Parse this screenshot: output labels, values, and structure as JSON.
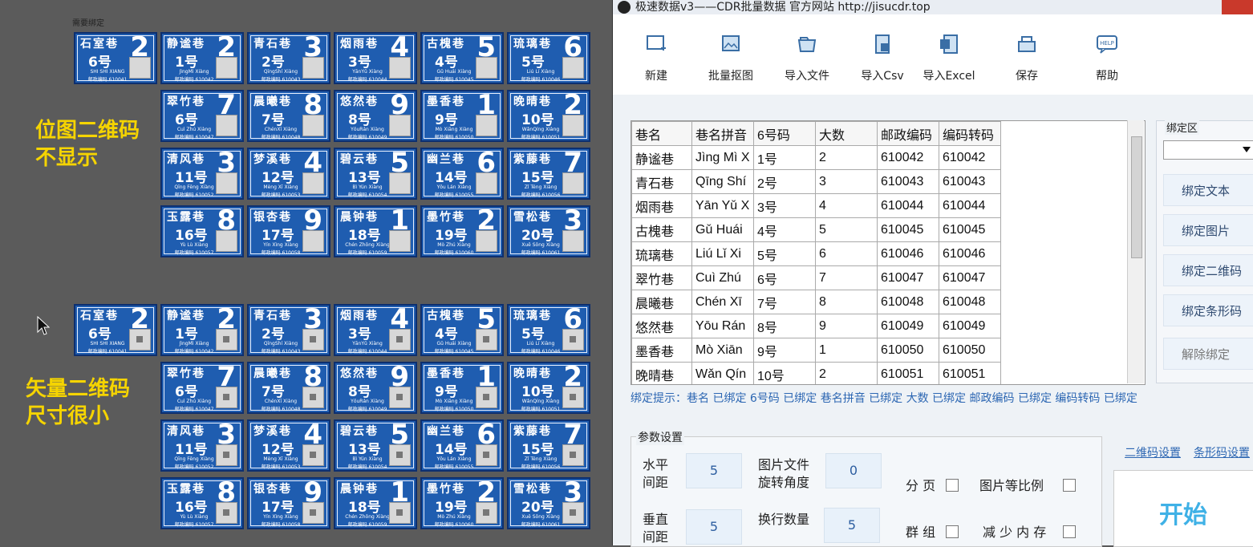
{
  "left": {
    "need_bind_label": "需要绑定",
    "callout_top": [
      "位图二维码",
      "不显示"
    ],
    "callout_bottom": [
      "矢量二维码",
      "尺寸很小"
    ]
  },
  "plates": [
    {
      "street": "石室巷",
      "hno": "6号",
      "big": "2",
      "py": "SHI SHI XIANG",
      "pc": "邮政编码 610041"
    },
    {
      "street": "静谧巷",
      "hno": "1号",
      "big": "2",
      "py": "JìngMì Xiàng",
      "pc": "邮政编码 610042"
    },
    {
      "street": "青石巷",
      "hno": "2号",
      "big": "3",
      "py": "QīngShí Xiàng",
      "pc": "邮政编码 610043"
    },
    {
      "street": "烟雨巷",
      "hno": "3号",
      "big": "4",
      "py": "YānYǔ Xiàng",
      "pc": "邮政编码 610044"
    },
    {
      "street": "古槐巷",
      "hno": "4号",
      "big": "5",
      "py": "Gǔ Huái Xiàng",
      "pc": "邮政编码 610045"
    },
    {
      "street": "琉璃巷",
      "hno": "5号",
      "big": "6",
      "py": "Liú Lí Xiàng",
      "pc": "邮政编码 610046"
    },
    {
      "street": "翠竹巷",
      "hno": "6号",
      "big": "7",
      "py": "Cuì Zhú Xiàng",
      "pc": "邮政编码 610047"
    },
    {
      "street": "晨曦巷",
      "hno": "7号",
      "big": "8",
      "py": "ChénXī Xiàng",
      "pc": "邮政编码 610048"
    },
    {
      "street": "悠然巷",
      "hno": "8号",
      "big": "9",
      "py": "YōuRán Xiàng",
      "pc": "邮政编码 610049"
    },
    {
      "street": "墨香巷",
      "hno": "9号",
      "big": "1",
      "py": "Mò Xiāng Xiàng",
      "pc": "邮政编码 610050"
    },
    {
      "street": "晚晴巷",
      "hno": "10号",
      "big": "2",
      "py": "WǎnQíng Xiàng",
      "pc": "邮政编码 610051"
    },
    {
      "street": "清风巷",
      "hno": "11号",
      "big": "3",
      "py": "Qīng Fēng Xiàng",
      "pc": "邮政编码 610052"
    },
    {
      "street": "梦溪巷",
      "hno": "12号",
      "big": "4",
      "py": "Mèng Xī Xiàng",
      "pc": "邮政编码 610053"
    },
    {
      "street": "碧云巷",
      "hno": "13号",
      "big": "5",
      "py": "Bì Yún Xiàng",
      "pc": "邮政编码 610054"
    },
    {
      "street": "幽兰巷",
      "hno": "14号",
      "big": "6",
      "py": "Yōu Lán Xiàng",
      "pc": "邮政编码 610055"
    },
    {
      "street": "紫藤巷",
      "hno": "15号",
      "big": "7",
      "py": "Zǐ Téng Xiàng",
      "pc": "邮政编码 610056"
    },
    {
      "street": "玉露巷",
      "hno": "16号",
      "big": "8",
      "py": "Yù Lù Xiàng",
      "pc": "邮政编码 610057"
    },
    {
      "street": "银杏巷",
      "hno": "17号",
      "big": "9",
      "py": "Yín Xìng Xiàng",
      "pc": "邮政编码 610058"
    },
    {
      "street": "晨钟巷",
      "hno": "18号",
      "big": "1",
      "py": "Chén Zhōng Xiàng",
      "pc": "邮政编码 610059"
    },
    {
      "street": "墨竹巷",
      "hno": "19号",
      "big": "2",
      "py": "Mò Zhú Xiàng",
      "pc": "邮政编码 610060"
    },
    {
      "street": "雪松巷",
      "hno": "20号",
      "big": "3",
      "py": "Xuě Sōng Xiàng",
      "pc": "邮政编码 610061"
    }
  ],
  "window": {
    "title": "极速数据v3——CDR批量数据  官方网站 http://jisucdr.top",
    "toolbar": [
      {
        "label": "新建",
        "icon": "new-icon"
      },
      {
        "label": "批量抠图",
        "icon": "image-icon"
      },
      {
        "label": "导入文件",
        "icon": "folder-icon"
      },
      {
        "label": "导入Csv",
        "icon": "csv-icon"
      },
      {
        "label": "导入Excel",
        "icon": "excel-icon"
      },
      {
        "label": "保存",
        "icon": "save-icon"
      },
      {
        "label": "帮助",
        "icon": "help-icon"
      }
    ],
    "help_icon_text": "HELP",
    "table": {
      "headers": [
        "巷名",
        "巷名拼音",
        "6号码",
        "大数",
        "邮政编码",
        "编码转码"
      ],
      "rows": [
        [
          "静谧巷",
          "Jìng Mì X",
          "1号",
          "2",
          "610042",
          "610042"
        ],
        [
          "青石巷",
          "Qīng Shí",
          "2号",
          "3",
          "610043",
          "610043"
        ],
        [
          "烟雨巷",
          "Yān Yǔ X",
          "3号",
          "4",
          "610044",
          "610044"
        ],
        [
          "古槐巷",
          "Gǔ Huái",
          "4号",
          "5",
          "610045",
          "610045"
        ],
        [
          "琉璃巷",
          "Liú Lǐ Xi",
          "5号",
          "6",
          "610046",
          "610046"
        ],
        [
          "翠竹巷",
          "Cuì Zhú",
          "6号",
          "7",
          "610047",
          "610047"
        ],
        [
          "晨曦巷",
          "Chén Xī",
          "7号",
          "8",
          "610048",
          "610048"
        ],
        [
          "悠然巷",
          "Yōu Rán",
          "8号",
          "9",
          "610049",
          "610049"
        ],
        [
          "墨香巷",
          "Mò Xiān",
          "9号",
          "1",
          "610050",
          "610050"
        ],
        [
          "晚晴巷",
          "Wǎn Qín",
          "10号",
          "2",
          "610051",
          "610051"
        ]
      ]
    },
    "bind_hint": "绑定提示：巷名 已绑定  6号码 已绑定  巷名拼音 已绑定  大数 已绑定  邮政编码 已绑定  编码转码 已绑定",
    "bind_area": {
      "label": "绑定区",
      "buttons": [
        "绑定文本",
        "绑定图片",
        "绑定二维码",
        "绑定条形码",
        "解除绑定"
      ]
    },
    "params": {
      "label": "参数设置",
      "h_spacing_label": [
        "水平",
        "间距"
      ],
      "h_spacing": "5",
      "rotate_label": [
        "图片文件",
        "旋转角度"
      ],
      "rotate": "0",
      "v_spacing_label": [
        "垂直",
        "间距"
      ],
      "v_spacing": "5",
      "wrap_label": "换行数量",
      "wrap": "5",
      "paging": "分 页",
      "ratio": "图片等比例",
      "group": "群 组",
      "reduce_mem": "减 少 内 存"
    },
    "tabs": [
      "二维码设置",
      "条形码设置"
    ],
    "watermark": "开始"
  }
}
